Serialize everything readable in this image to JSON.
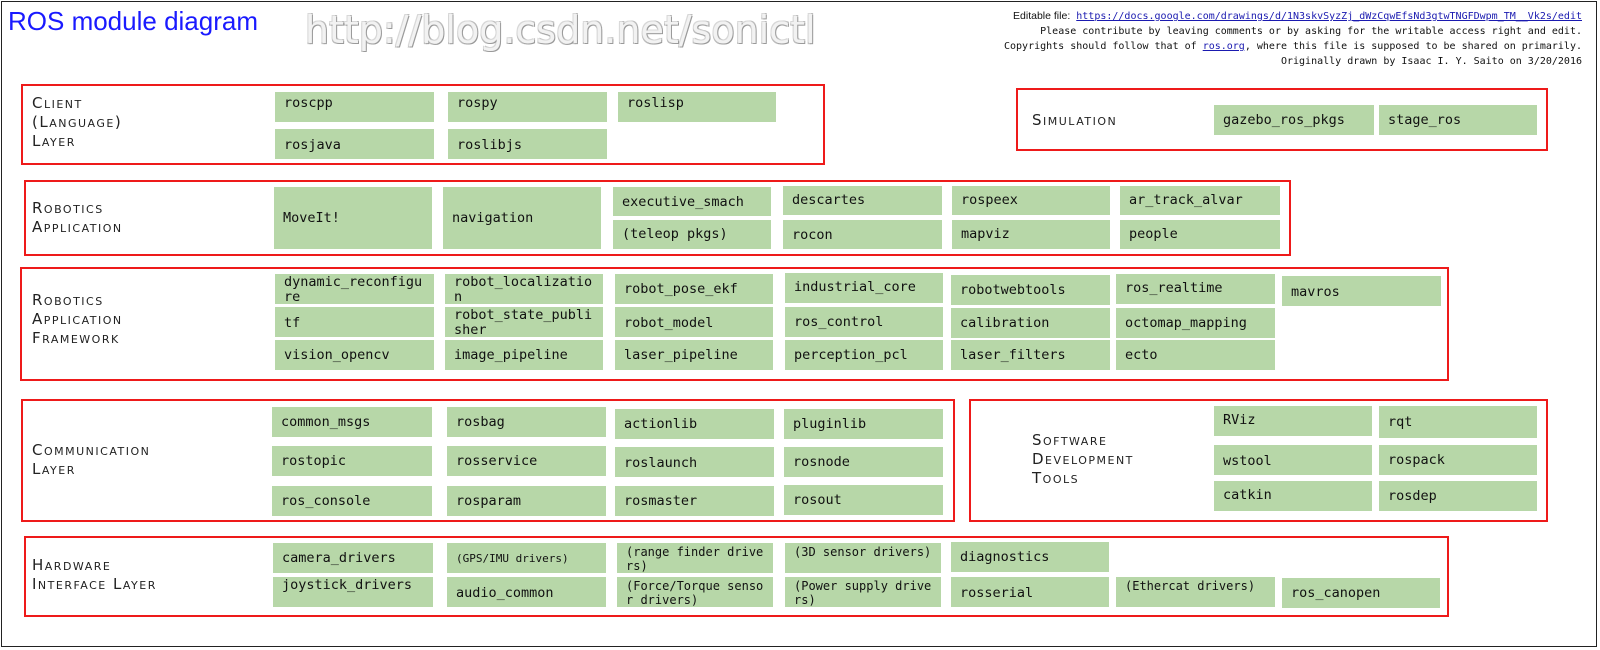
{
  "title": "ROS module diagram",
  "watermark": "http://blog.csdn.net/sonictl",
  "info": {
    "editable_label": "Editable file:",
    "editable_url": "https://docs.google.com/drawings/d/1N3skvSyzZj_dWzCqwEfsNd3gtwTNGFDwpm_TM__Vk2s/edit",
    "line2": "Please contribute by leaving comments or by asking for the writable access right and edit.",
    "line3_pre": "Copyrights should follow that of",
    "line3_link": "ros.org",
    "line3_post": ", where this file is supposed to be shared on primarily.",
    "line4": "Originally drawn by Isaac I. Y. Saito on 3/20/2016"
  },
  "sections": {
    "client": {
      "label": "Client\n(Language)\nLayer",
      "packages": [
        "roscpp",
        "rospy",
        "roslisp",
        "rosjava",
        "roslibjs"
      ]
    },
    "simulation": {
      "label": "Simulation",
      "packages": [
        "gazebo_ros_pkgs",
        "stage_ros"
      ]
    },
    "robotics_app": {
      "label": "Robotics\nApplication",
      "packages": [
        "MoveIt!",
        "navigation",
        "executive_smach",
        "(teleop pkgs)",
        "descartes",
        "rocon",
        "rospeex",
        "mapviz",
        "ar_track_alvar",
        "people"
      ]
    },
    "framework": {
      "label": "Robotics\nApplication\nFramework",
      "packages": [
        "dynamic_reconfigure",
        "robot_localization",
        "robot_pose_ekf",
        "industrial_core",
        "robotwebtools",
        "ros_realtime",
        "mavros",
        "tf",
        "robot_state_publisher",
        "robot_model",
        "ros_control",
        "calibration",
        "octomap_mapping",
        "vision_opencv",
        "image_pipeline",
        "laser_pipeline",
        "perception_pcl",
        "laser_filters",
        "ecto"
      ]
    },
    "communication": {
      "label": "Communication\nLayer",
      "packages": [
        "common_msgs",
        "rosbag",
        "actionlib",
        "pluginlib",
        "rostopic",
        "rosservice",
        "roslaunch",
        "rosnode",
        "ros_console",
        "rosparam",
        "rosmaster",
        "rosout"
      ]
    },
    "sdk": {
      "label": "Software\nDevelopment\nTools",
      "packages": [
        "RViz",
        "rqt",
        "wstool",
        "rospack",
        "catkin",
        "rosdep"
      ]
    },
    "hardware": {
      "label": "Hardware\nInterface Layer",
      "packages": [
        "camera_drivers",
        "(GPS/IMU drivers)",
        "(range finder drivers)",
        "(3D sensor drivers)",
        "diagnostics",
        "joystick_drivers",
        "audio_common",
        "(Force/Torque sensor drivers)",
        "(Power supply drivers)",
        "rosserial",
        "(Ethercat drivers)",
        "ros_canopen"
      ]
    }
  },
  "colors": {
    "section_border": "#ee1a1a",
    "package_fill": "#b7d7a8",
    "title": "#1a1aff"
  }
}
